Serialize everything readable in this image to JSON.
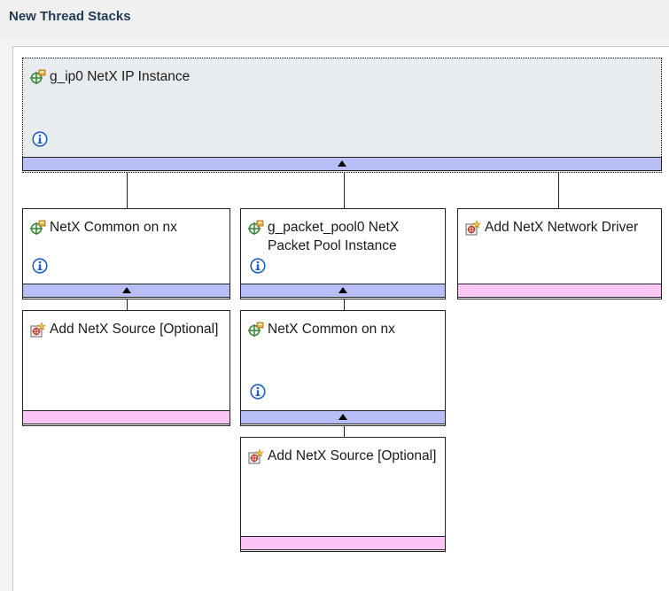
{
  "header": {
    "title": "New Thread Stacks"
  },
  "cards": {
    "ip": {
      "title": "g_ip0 NetX IP Instance",
      "icon": "module-icon"
    },
    "common1": {
      "title": "NetX Common on nx",
      "icon": "module-icon"
    },
    "pool": {
      "title": "g_packet_pool0 NetX Packet Pool Instance",
      "icon": "module-icon"
    },
    "driver": {
      "title": "Add NetX Network Driver",
      "icon": "add-module-icon"
    },
    "source1": {
      "title": "Add NetX Source [Optional]",
      "icon": "add-module-icon"
    },
    "common2": {
      "title": "NetX Common on nx",
      "icon": "module-icon"
    },
    "source2": {
      "title": "Add NetX Source [Optional]",
      "icon": "add-module-icon"
    }
  },
  "colors": {
    "bar_blue": "#b8bff7",
    "bar_pink": "#fbc5f5",
    "info_blue": "#1f5fbf"
  }
}
